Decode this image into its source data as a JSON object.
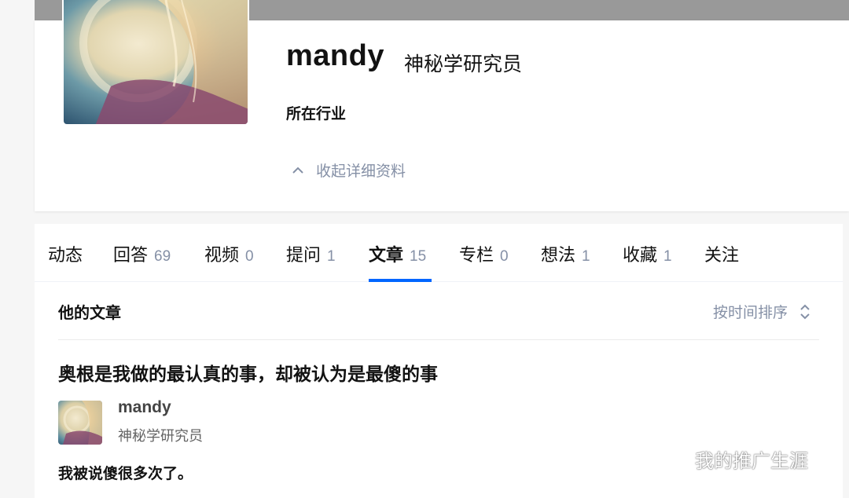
{
  "profile": {
    "name": "mandy",
    "headline": "神秘学研究员",
    "industry_label": "所在行业",
    "collapse_label": "收起详细资料"
  },
  "tabs": [
    {
      "label": "动态",
      "count": ""
    },
    {
      "label": "回答",
      "count": "69"
    },
    {
      "label": "视频",
      "count": "0"
    },
    {
      "label": "提问",
      "count": "1"
    },
    {
      "label": "文章",
      "count": "15"
    },
    {
      "label": "专栏",
      "count": "0"
    },
    {
      "label": "想法",
      "count": "1"
    },
    {
      "label": "收藏",
      "count": "1"
    },
    {
      "label": "关注",
      "count": ""
    }
  ],
  "active_tab": "文章",
  "section": {
    "title": "他的文章",
    "sort_label": "按时间排序"
  },
  "article": {
    "title": "奥根是我做的最认真的事，却被认为是最傻的事",
    "author_name": "mandy",
    "author_headline": "神秘学研究员",
    "excerpt": "我被说傻很多次了。"
  },
  "watermark": {
    "text": "我的推广生涯",
    "icon": "wechat-icon"
  },
  "colors": {
    "accent": "#0066ff",
    "muted": "#8590a6",
    "cover": "#999999"
  }
}
